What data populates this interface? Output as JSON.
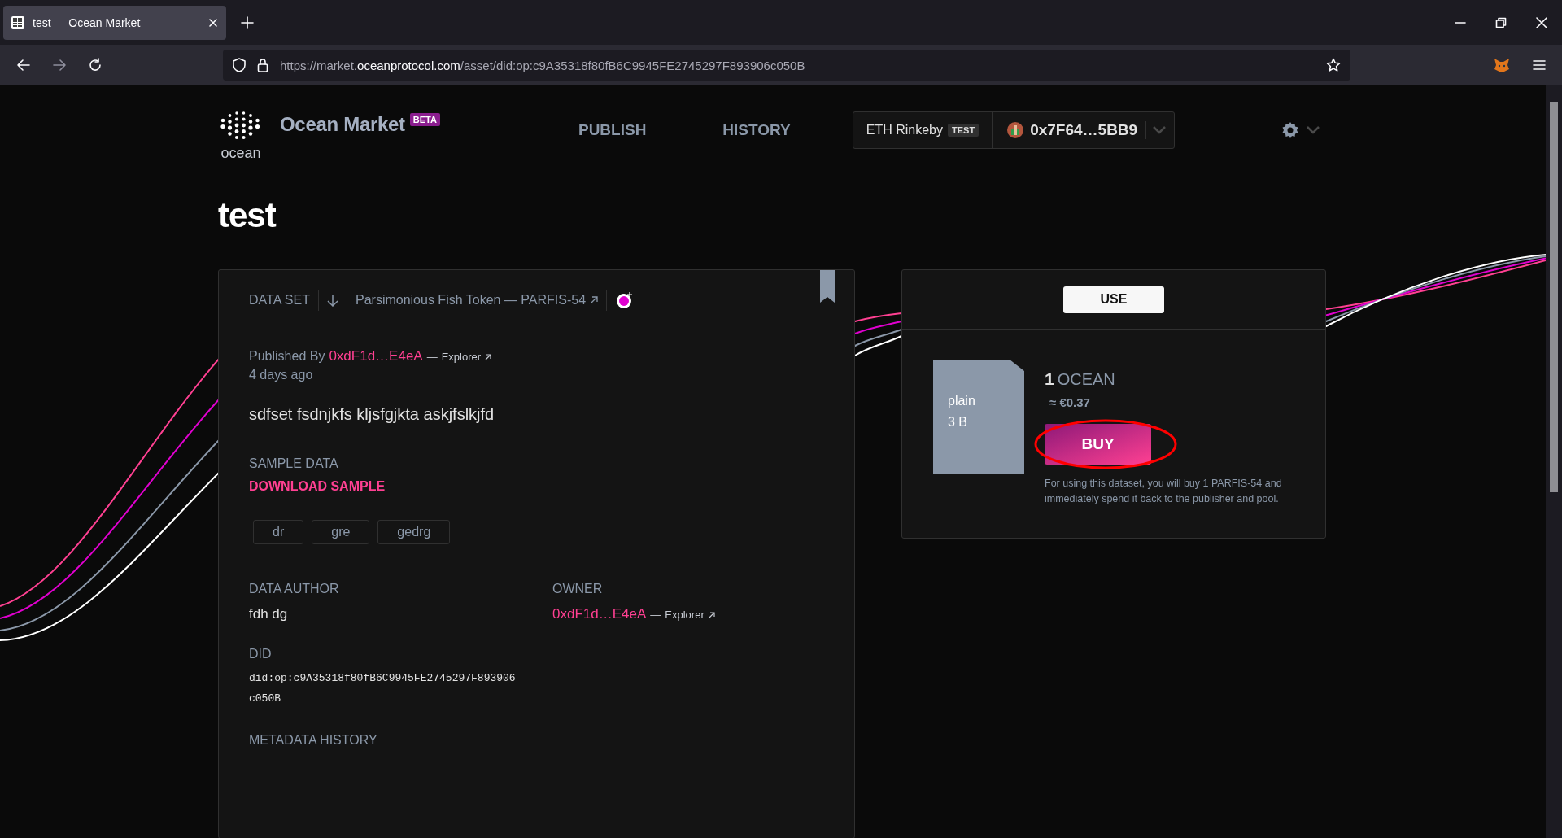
{
  "browser": {
    "tab_title": "test — Ocean Market",
    "url": "https://market.**oceanprotocol.com**/asset/did:op:c9A35318f80fB6C9945FE2745297F893906c050B"
  },
  "header": {
    "logo_text": "ocean",
    "brand": "Ocean Market",
    "badge": "BETA",
    "nav": [
      {
        "label": "PUBLISH"
      },
      {
        "label": "HISTORY"
      }
    ],
    "network": "ETH Rinkeby",
    "network_badge": "TEST",
    "account": "0x7F64…5BB9"
  },
  "title": "test",
  "asset": {
    "type": "DATA SET",
    "token": "Parsimonious Fish Token — PARFIS-54",
    "published_by": "Published By",
    "publisher": "0xdF1d…E4eA",
    "separator": "—",
    "explorer": "Explorer",
    "published_when": "4 days ago",
    "description": "sdfset fsdnjkfs kljsfgjkta askjfslkjfd",
    "sample_label": "SAMPLE DATA",
    "sample_link": "DOWNLOAD SAMPLE",
    "tags": [
      "dr",
      "gre",
      "gedrg"
    ],
    "author_label": "DATA AUTHOR",
    "author": "fdh dg",
    "owner_label": "OWNER",
    "owner": "0xdF1d…E4eA",
    "owner_separator": "—",
    "owner_explorer": "Explorer",
    "did_label": "DID",
    "did": "did:op:c9A35318f80fB6C9945FE2745297F893906c050B",
    "metadata_label": "METADATA HISTORY"
  },
  "buy": {
    "tab": "USE",
    "file_type": "plain",
    "file_size": "3 B",
    "price_amount": "1",
    "price_unit": "OCEAN",
    "price_fiat": "≈ €0.37",
    "button": "BUY",
    "note": "For using this dataset, you will buy 1 PARFIS-54 and immediately spend it back to the publisher and pool."
  }
}
